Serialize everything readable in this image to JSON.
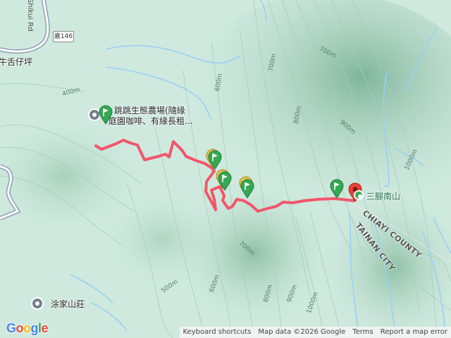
{
  "map": {
    "places": {
      "niushepo": "牛舌仔坪",
      "tujia": "涂家山莊",
      "farm_line1": "跳跳生態農場(隨緣",
      "farm_line2": "庭園咖啡、有緣長租..."
    },
    "peak": "三腳南山",
    "road_shield": "嘉146",
    "road_name": "Shikui Rd",
    "counties": [
      "CHIAYI COUNTY",
      "TAINAN CITY"
    ],
    "contours": [
      "400m",
      "500m",
      "600m",
      "700m",
      "800m",
      "900m",
      "1000m",
      "700m",
      "600m",
      "700m",
      "800m",
      "900m",
      "1000m"
    ],
    "colors": {
      "track": "#f2566b",
      "flag": "#34a853",
      "pin": "#ea4335",
      "water": "#9ad0f5"
    },
    "icons": [
      "start-flag-icon",
      "waypoint-flag-icon",
      "destination-pin-icon",
      "poi-circle-icon"
    ]
  },
  "attribution": {
    "keyboard": "Keyboard shortcuts",
    "data": "Map data ©2026 Google",
    "terms": "Terms",
    "report": "Report a map error"
  },
  "logo": "Google"
}
